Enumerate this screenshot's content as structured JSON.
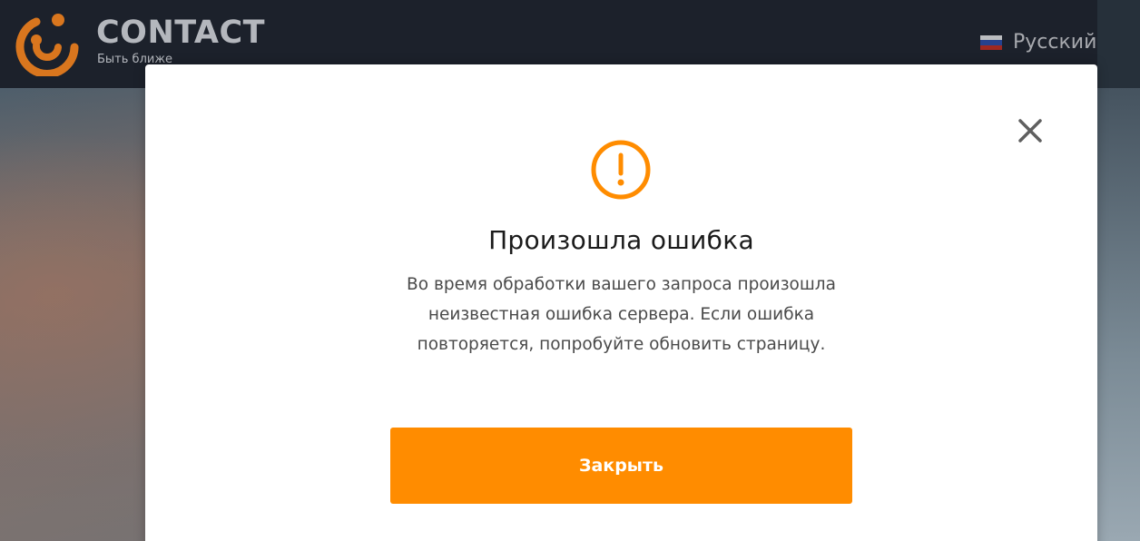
{
  "header": {
    "brand": "CONTACT",
    "tagline": "Быть ближе",
    "language": {
      "label": "Русский",
      "flag": "russia-flag"
    }
  },
  "dialog": {
    "icon": "alert-circle-icon",
    "title": "Произошла ошибка",
    "message_lines": [
      "Во время обработки вашего запроса произошла",
      "неизвестная ошибка сервера. Если ошибка",
      "повторяется, попробуйте обновить страницу."
    ],
    "close_button_label": "Закрыть"
  },
  "colors": {
    "accent": "#ff8c00",
    "header_bg": "#1c212b",
    "brand_orange": "#d9761e"
  }
}
